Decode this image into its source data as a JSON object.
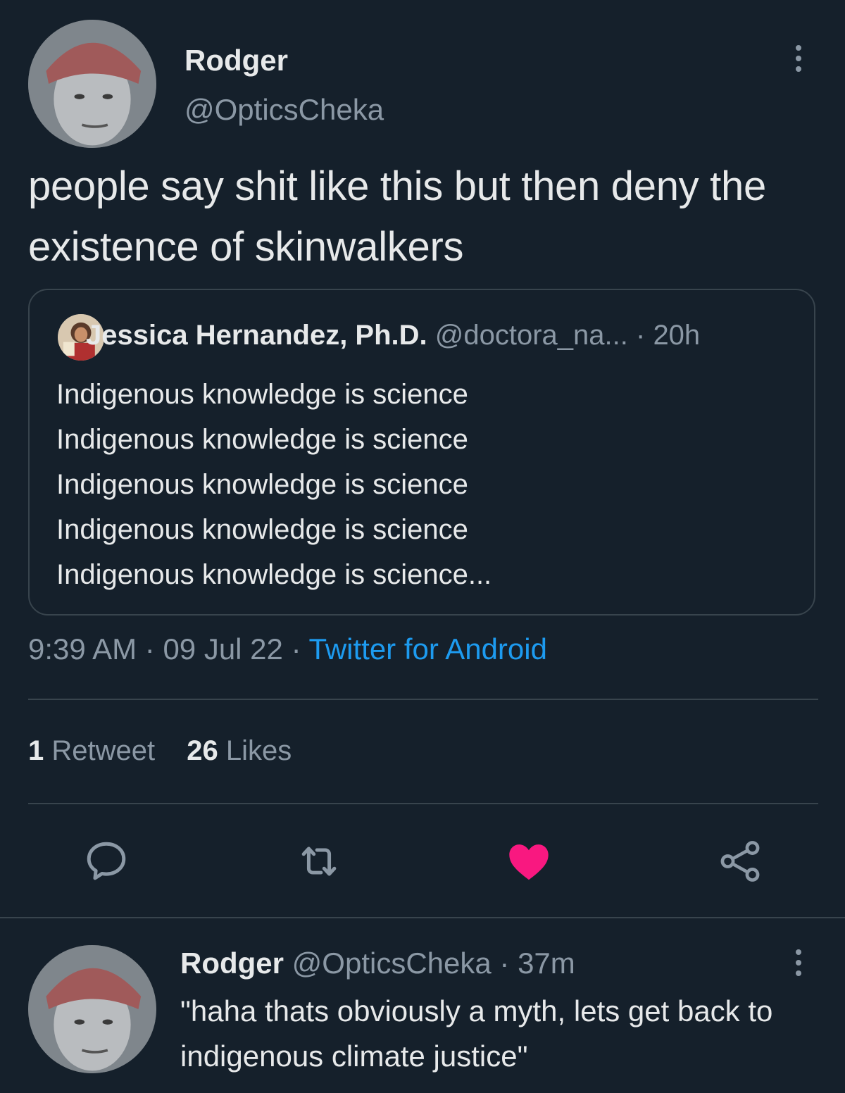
{
  "tweet": {
    "author_name": "Rodger",
    "author_handle": "@OpticsCheka",
    "text": "people say shit like this but then deny the existence of skinwalkers",
    "quoted": {
      "author_name": "Jessica Hernandez, Ph.D.",
      "author_handle": "@doctora_na...",
      "separator": " · ",
      "age": "20h",
      "lines": [
        "Indigenous knowledge is science",
        "Indigenous knowledge is science",
        "Indigenous knowledge is science",
        "Indigenous knowledge is science",
        "Indigenous knowledge is science..."
      ]
    },
    "time": "9:39 AM",
    "date": "09 Jul 22",
    "separator": " · ",
    "source": "Twitter for Android",
    "retweet_count": "1",
    "retweet_label": "Retweet",
    "like_count": "26",
    "like_label": "Likes"
  },
  "actions": {
    "reply_icon": "reply-icon",
    "retweet_icon": "retweet-icon",
    "like_icon": "heart-icon",
    "share_icon": "share-icon",
    "liked_color": "#f91880",
    "icon_color": "#8b98a5"
  },
  "reply": {
    "author_name": "Rodger",
    "author_handle": "@OpticsCheka",
    "separator": " · ",
    "age": "37m",
    "text": "\"haha thats obviously a myth, lets get back to indigenous climate justice\""
  }
}
